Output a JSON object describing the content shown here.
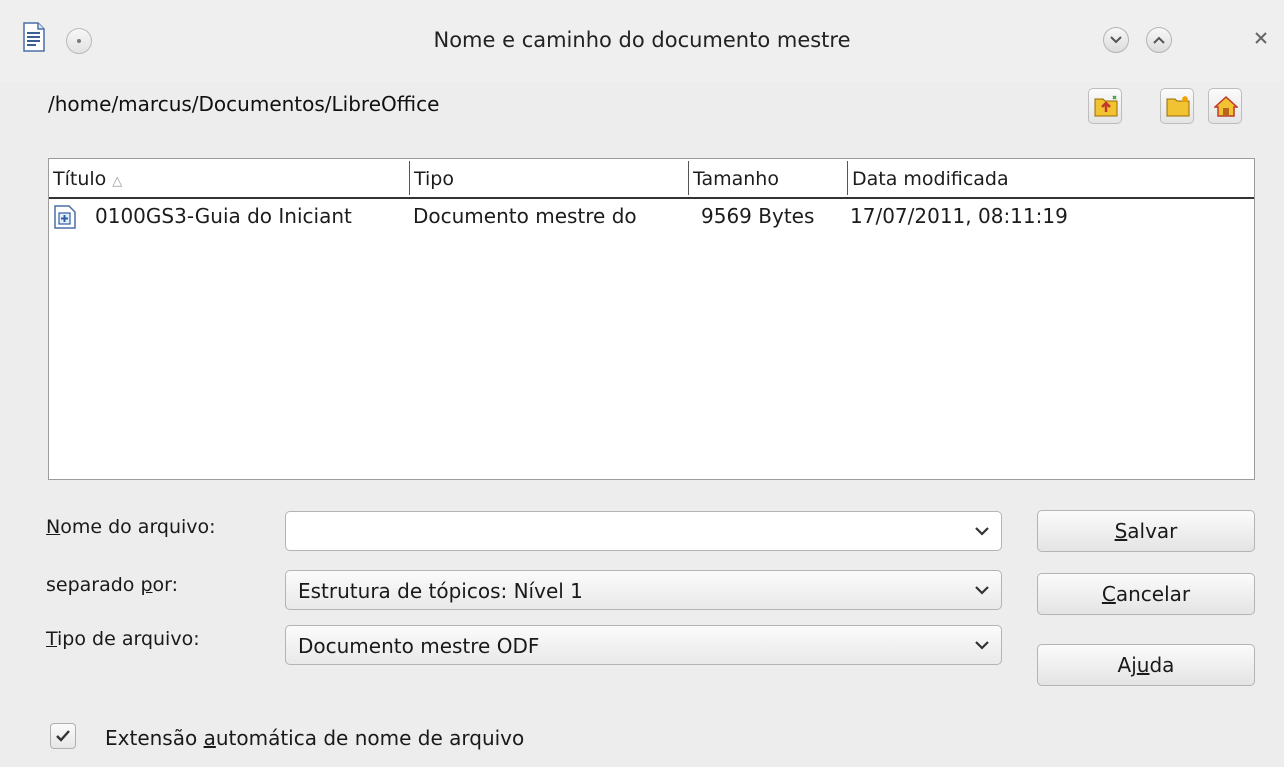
{
  "window": {
    "title": "Nome e caminho do documento mestre"
  },
  "location": {
    "path": "/home/marcus/Documentos/LibreOffice"
  },
  "list": {
    "columns": [
      "Título",
      "Tipo",
      "Tamanho",
      "Data modificada"
    ],
    "sort_indicator": "△",
    "rows": [
      {
        "title": "0100GS3-Guia do Iniciant",
        "type": "Documento mestre do",
        "size": "9569 Bytes",
        "modified": "17/07/2011, 08:11:19"
      }
    ]
  },
  "form": {
    "filename": {
      "label_u": "N",
      "label_rest": "ome do arquivo:",
      "value": ""
    },
    "separated_by": {
      "label_pre": "separado ",
      "label_u": "p",
      "label_rest": "or:",
      "value": "Estrutura de tópicos: Nível 1"
    },
    "file_type": {
      "label_u": "T",
      "label_rest": "ipo de arquivo:",
      "value": "Documento mestre ODF"
    }
  },
  "buttons": {
    "save": {
      "u": "S",
      "rest": "alvar"
    },
    "cancel": {
      "u": "C",
      "rest": "ancelar"
    },
    "help": {
      "pre": "Aj",
      "u": "u",
      "rest": "da"
    }
  },
  "auto_extension": {
    "checked": true,
    "pre": "Extensão ",
    "u": "a",
    "rest": "utomática de nome de arquivo"
  }
}
